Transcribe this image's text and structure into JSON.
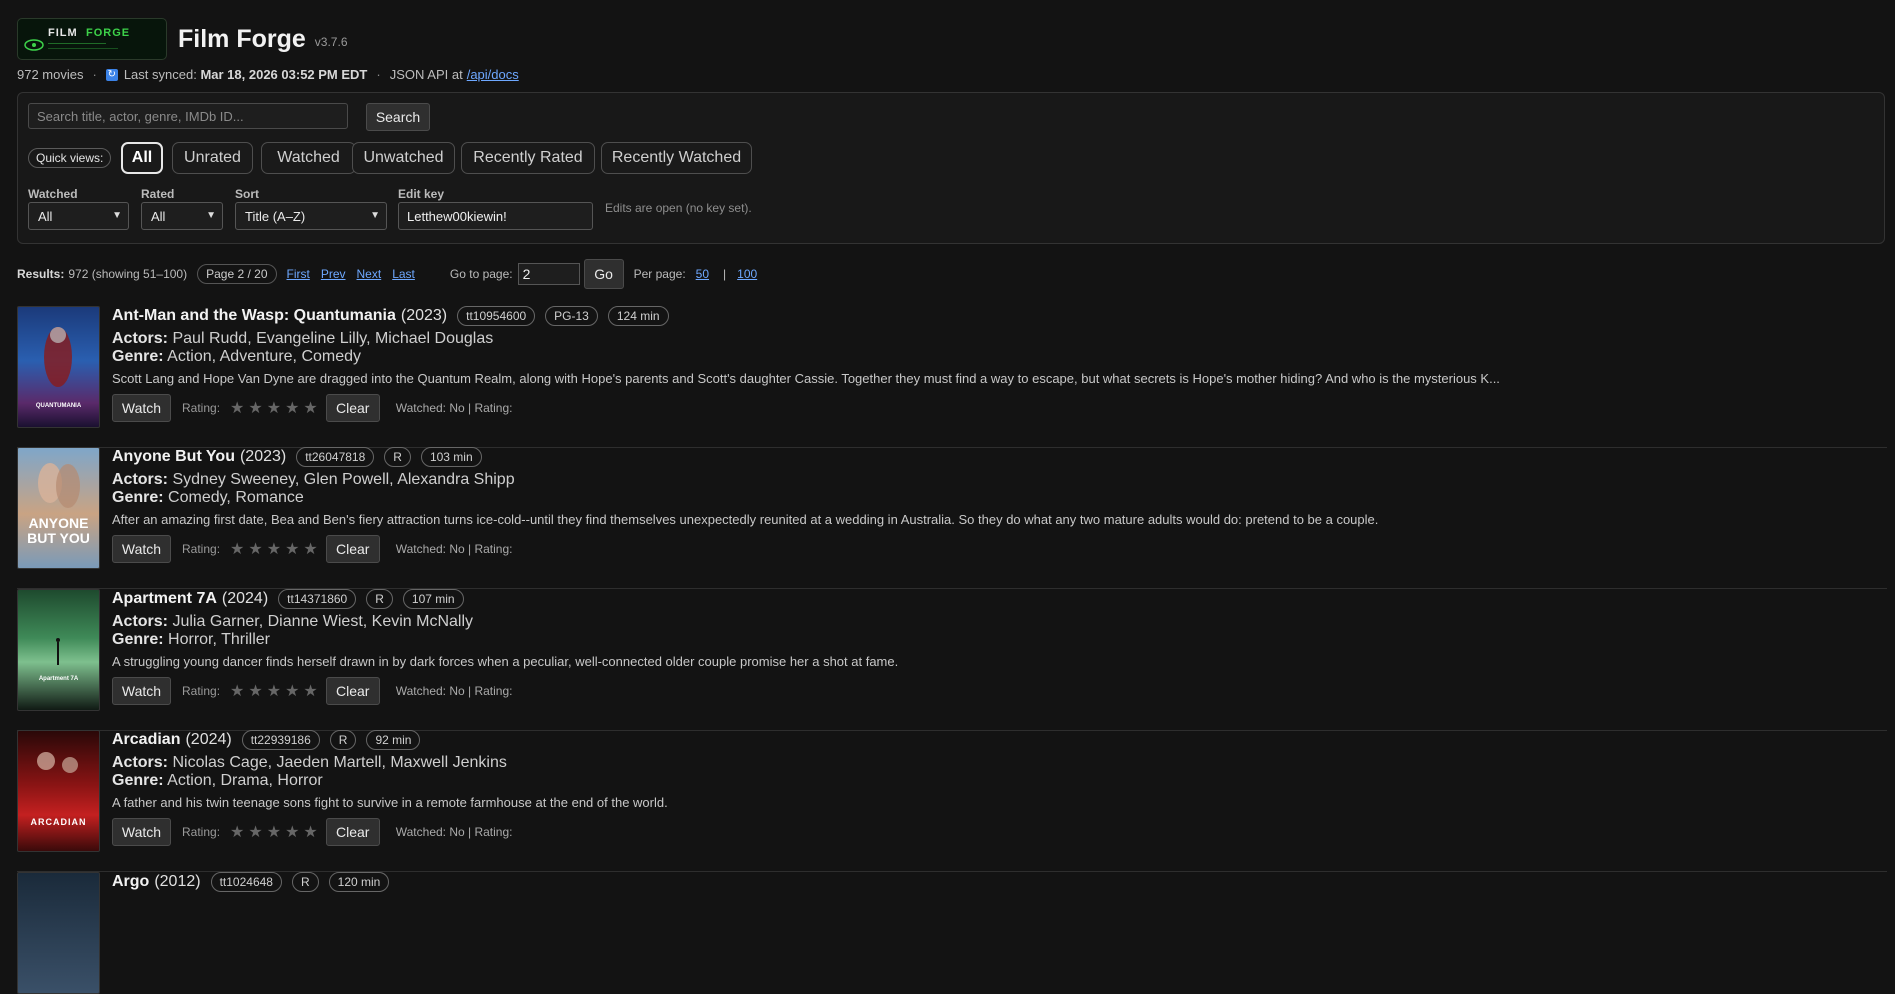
{
  "app": {
    "logo_word1": "FILM",
    "logo_word2": "FORGE",
    "title": "Film Forge",
    "version": "v3.7.6"
  },
  "meta": {
    "count": "972 movies",
    "sync_prefix": "Last synced:",
    "sync_time": "Mar 18, 2026 03:52 PM EDT",
    "api_prefix": "JSON API at",
    "api_link": "/api/docs"
  },
  "search": {
    "placeholder": "Search title, actor, genre, IMDb ID...",
    "button": "Search"
  },
  "quick_views": {
    "label": "Quick views:",
    "items": [
      "All",
      "Unrated",
      "Watched",
      "Unwatched",
      "Recently Rated",
      "Recently Watched"
    ],
    "active": "All"
  },
  "filters": {
    "watched": {
      "label": "Watched",
      "value": "All"
    },
    "rated": {
      "label": "Rated",
      "value": "All"
    },
    "sort": {
      "label": "Sort",
      "value": "Title (A–Z)"
    },
    "edit_key": {
      "label": "Edit key",
      "value": "Letthew00kiewin!"
    },
    "edit_note": "Edits are open (no key set)."
  },
  "pager": {
    "results_label": "Results:",
    "results_text": "972 (showing 51–100)",
    "page_pill": "Page 2 / 20",
    "first": "First",
    "prev": "Prev",
    "next": "Next",
    "last": "Last",
    "goto_label": "Go to page:",
    "goto_value": "2",
    "go": "Go",
    "per_page_label": "Per page:",
    "per_page_50": "50",
    "per_page_sep": "|",
    "per_page_100": "100"
  },
  "common": {
    "watch": "Watch",
    "rating_label": "Rating:",
    "stars": "★★★★★",
    "clear": "Clear",
    "status": "Watched: No | Rating:",
    "actors_label": "Actors:",
    "genre_label": "Genre:"
  },
  "movies": [
    {
      "title": "Ant-Man and the Wasp: Quantumania",
      "year": "(2023)",
      "imdb": "tt10954600",
      "rating": "PG-13",
      "runtime": "124 min",
      "actors": "Paul Rudd, Evangeline Lilly, Michael Douglas",
      "genre": "Action, Adventure, Comedy",
      "plot": "Scott Lang and Hope Van Dyne are dragged into the Quantum Realm, along with Hope's parents and Scott's daughter Cassie. Together they must find a way to escape, but what secrets is Hope's mother hiding? And who is the mysterious K...",
      "poster_text": "QUANTUMANIA"
    },
    {
      "title": "Anyone But You",
      "year": "(2023)",
      "imdb": "tt26047818",
      "rating": "R",
      "runtime": "103 min",
      "actors": "Sydney Sweeney, Glen Powell, Alexandra Shipp",
      "genre": "Comedy, Romance",
      "plot": "After an amazing first date, Bea and Ben's fiery attraction turns ice-cold--until they find themselves unexpectedly reunited at a wedding in Australia. So they do what any two mature adults would do: pretend to be a couple.",
      "poster_text": "ANYONE BUT YOU"
    },
    {
      "title": "Apartment 7A",
      "year": "(2024)",
      "imdb": "tt14371860",
      "rating": "R",
      "runtime": "107 min",
      "actors": "Julia Garner, Dianne Wiest, Kevin McNally",
      "genre": "Horror, Thriller",
      "plot": "A struggling young dancer finds herself drawn in by dark forces when a peculiar, well-connected older couple promise her a shot at fame.",
      "poster_text": "Apartment 7A"
    },
    {
      "title": "Arcadian",
      "year": "(2024)",
      "imdb": "tt22939186",
      "rating": "R",
      "runtime": "92 min",
      "actors": "Nicolas Cage, Jaeden Martell, Maxwell Jenkins",
      "genre": "Action, Drama, Horror",
      "plot": "A father and his twin teenage sons fight to survive in a remote farmhouse at the end of the world.",
      "poster_text": "ARCADIAN"
    },
    {
      "title": "Argo",
      "year": "(2012)",
      "imdb": "tt1024648",
      "rating": "R",
      "runtime": "120 min",
      "actors": "",
      "genre": "",
      "plot": "",
      "poster_text": ""
    }
  ]
}
